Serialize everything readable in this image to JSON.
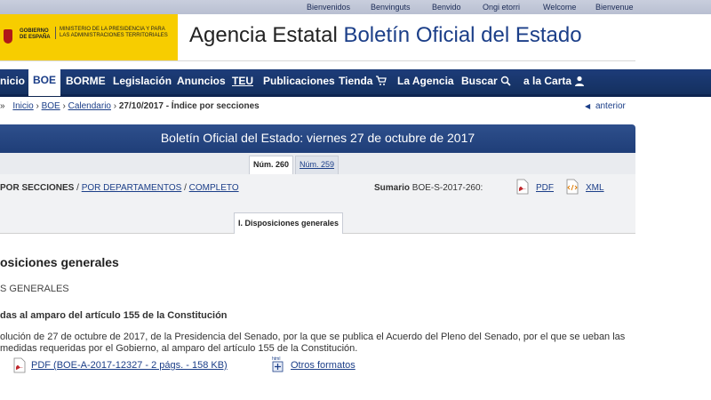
{
  "top_bar": {
    "languages": [
      "Bienvenidos",
      "Benvinguts",
      "Benvido",
      "Ongi etorri",
      "Welcome",
      "Bienvenue"
    ]
  },
  "header": {
    "government": "GOBIERNO DE ESPAÑA",
    "ministry": "MINISTERIO DE LA PRESIDENCIA Y PARA LAS ADMINISTRACIONES TERRITORIALES",
    "title_prefix": "Agencia Estatal ",
    "title_main": "Boletín Oficial del Estado"
  },
  "nav": {
    "items": [
      "nicio",
      "BOE",
      "BORME",
      "Legislación",
      "Anuncios",
      "TEU",
      "Publicaciones",
      "Tienda",
      "La Agencia",
      "Buscar",
      "a la Carta"
    ]
  },
  "breadcrumb": {
    "items": [
      "Inicio",
      "BOE",
      "Calendario"
    ],
    "current": "27/10/2017 - Índice por secciones",
    "back": "anterior"
  },
  "band": {
    "title": "Boletín Oficial del Estado: viernes 27 de octubre de 2017"
  },
  "issue_tabs": {
    "selected": "Núm. 260",
    "other": "Núm. 259"
  },
  "index_links": {
    "by_section": "POR SECCIONES",
    "by_department": "POR DEPARTAMENTOS",
    "complete": "COMPLETO",
    "summary_label": "Sumario",
    "summary_id": "BOE-S-2017-260:",
    "pdf": "PDF",
    "xml": "XML"
  },
  "section_tab": "I. Disposiciones generales",
  "content": {
    "heading": "osiciones generales",
    "subheading": "S GENERALES",
    "article": "das al amparo del artículo 155 de la Constitución",
    "description": "olución de 27 de octubre de 2017, de la Presidencia del Senado, por la que se publica el Acuerdo del Pleno del Senado, por el que se ueban las medidas requeridas por el Gobierno, al amparo del artículo 155 de la Constitución.",
    "pdf_link": "PDF (BOE-A-2017-12327 - 2 págs. - 158 KB)",
    "other_formats": "Otros formatos",
    "html_icon_label": "html"
  },
  "colors": {
    "navy": "#1b3e88",
    "band": "#2e4f8c",
    "ministry_yellow": "#f7cd00",
    "pdf_red": "#c0282d"
  }
}
